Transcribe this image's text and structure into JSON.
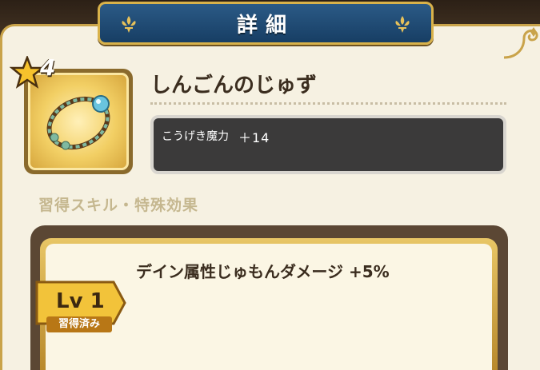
{
  "header": {
    "title": "詳細"
  },
  "item": {
    "name": "しんごんのじゅず",
    "rarity": "4",
    "icon": "prayer-beads-icon",
    "stat": {
      "label": "こうげき魔力",
      "value": "＋14"
    }
  },
  "skills": {
    "section_title": "習得スキル・特殊効果",
    "list": [
      {
        "level_label": "Lv 1",
        "status": "習得済み",
        "description": "デイン属性じゅもんダメージ +5%"
      }
    ]
  },
  "colors": {
    "banner": "#1f4c78",
    "banner_border": "#d9b24a",
    "panel_bg": "#f6f1e2",
    "stat_bg": "#3b3a3a",
    "level_tag": "#f2c33a",
    "learned_badge": "#b87716"
  }
}
